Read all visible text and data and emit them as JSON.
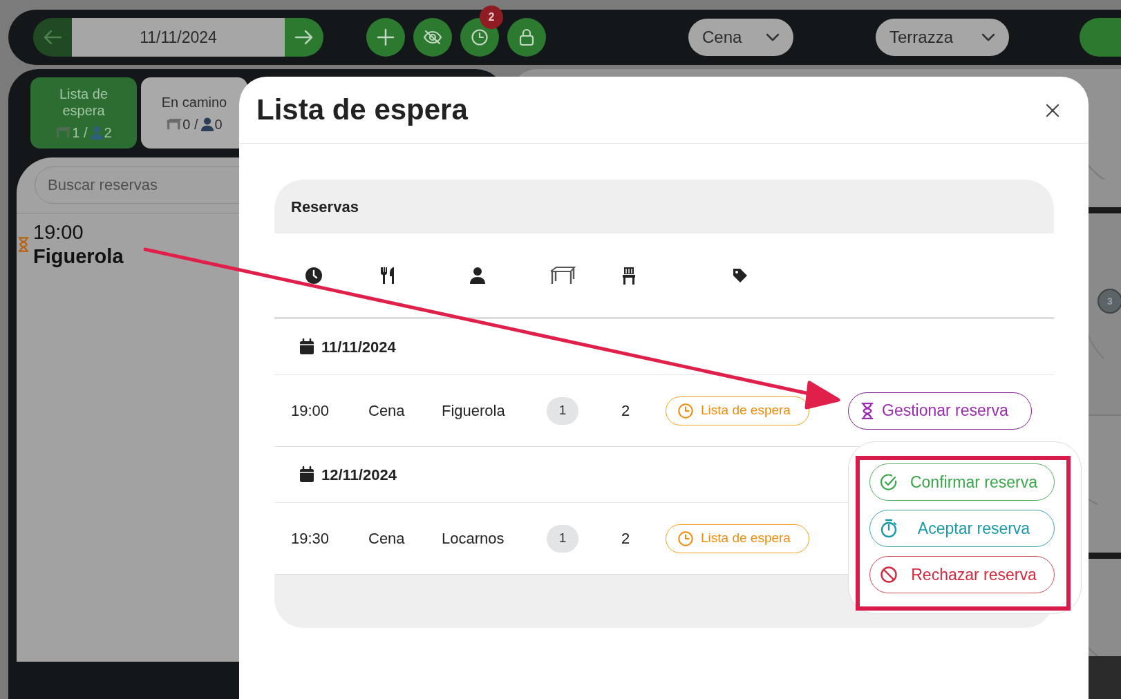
{
  "toolbar": {
    "date": "11/11/2024",
    "badge": "2",
    "service": "Cena",
    "zone": "Terrazza"
  },
  "tabs": [
    {
      "label": "Lista de espera",
      "tables": "1 /",
      "guests": "2",
      "selected": true
    },
    {
      "label": "En camino",
      "tables": "0 /",
      "guests": "0",
      "selected": false
    }
  ],
  "search": {
    "placeholder": "Buscar reservas"
  },
  "sidebar_items": [
    {
      "time": "19:00",
      "name": "Figuerola"
    }
  ],
  "floor_plan": {
    "table_marker": "3"
  },
  "modal": {
    "title": "Lista de espera",
    "card_title": "Reservas",
    "groups": [
      {
        "date": "11/11/2024",
        "rows": [
          {
            "time": "19:00",
            "service": "Cena",
            "name": "Figuerola",
            "tables": "1",
            "guests": "2",
            "status": "Lista de espera",
            "action": "Gestionar reserva"
          }
        ]
      },
      {
        "date": "12/11/2024",
        "rows": [
          {
            "time": "19:30",
            "service": "Cena",
            "name": "Locarnos",
            "tables": "1",
            "guests": "2",
            "status": "Lista de espera"
          }
        ]
      }
    ],
    "menu": [
      {
        "label": "Confirmar reserva",
        "kind": "confirm"
      },
      {
        "label": "Aceptar reserva",
        "kind": "accept"
      },
      {
        "label": "Rechazar reserva",
        "kind": "reject"
      }
    ]
  }
}
